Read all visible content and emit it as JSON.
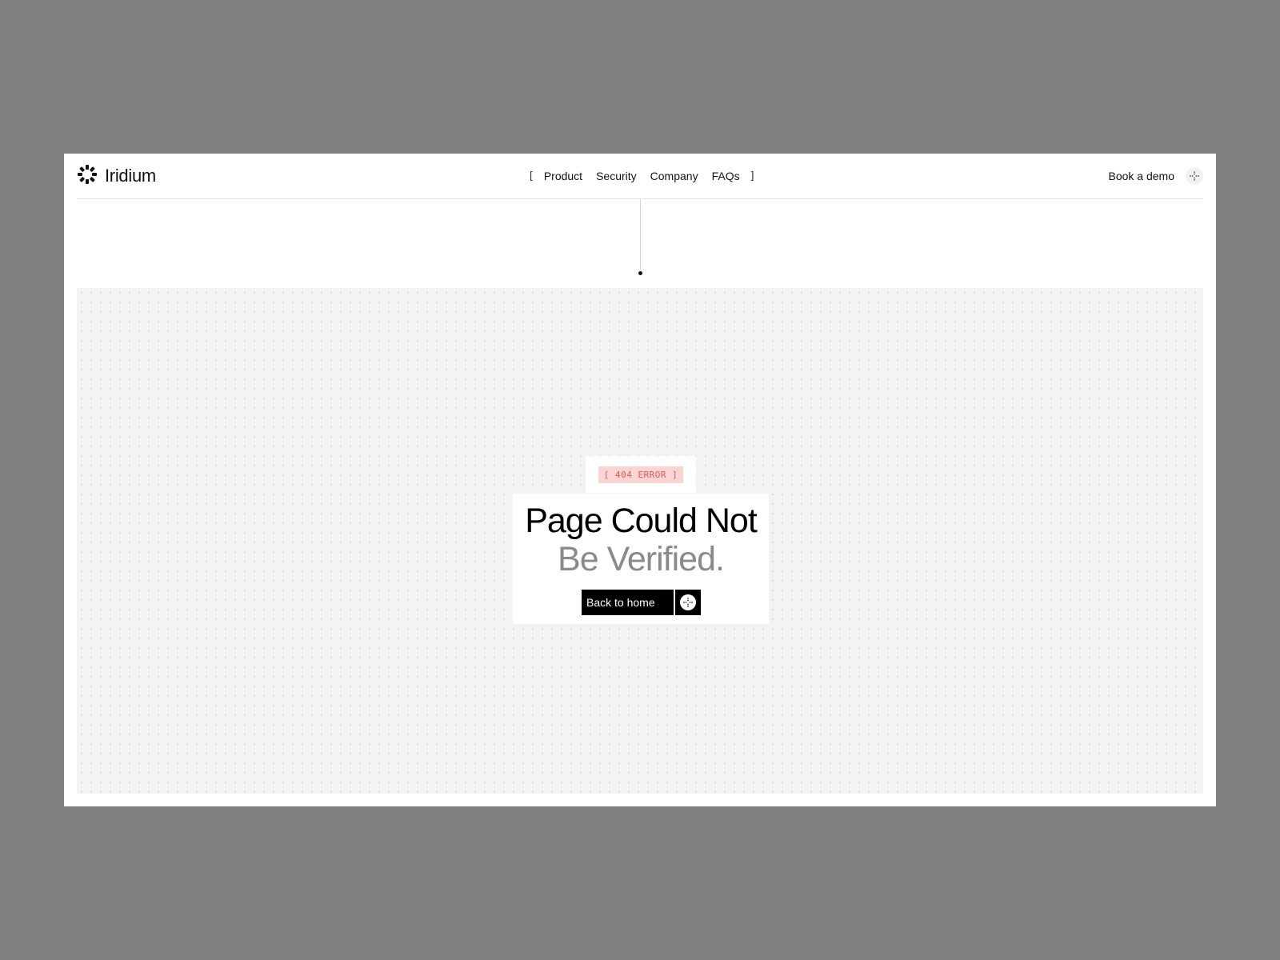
{
  "header": {
    "brand": {
      "name": "Iridium",
      "icon": "iridium-logo-icon"
    },
    "nav": {
      "bracket_open": "[",
      "bracket_close": "]",
      "items": [
        {
          "label": "Product"
        },
        {
          "label": "Security"
        },
        {
          "label": "Company"
        },
        {
          "label": "FAQs"
        }
      ]
    },
    "cta": {
      "label": "Book a demo",
      "icon": "crosshair-icon"
    }
  },
  "error": {
    "badge": "[ 404 ERROR ]",
    "title_line1": "Page Could Not",
    "title_line2": "Be Verified.",
    "button_label": "Back to home",
    "button_icon": "crosshair-icon"
  },
  "colors": {
    "page_frame": "#808080",
    "content_bg": "#f3f3f3",
    "badge_bg": "#fbd4d4",
    "badge_text": "#e05a5a",
    "title_primary": "#000000",
    "title_secondary": "#8a8a8a",
    "button_bg": "#000000"
  }
}
